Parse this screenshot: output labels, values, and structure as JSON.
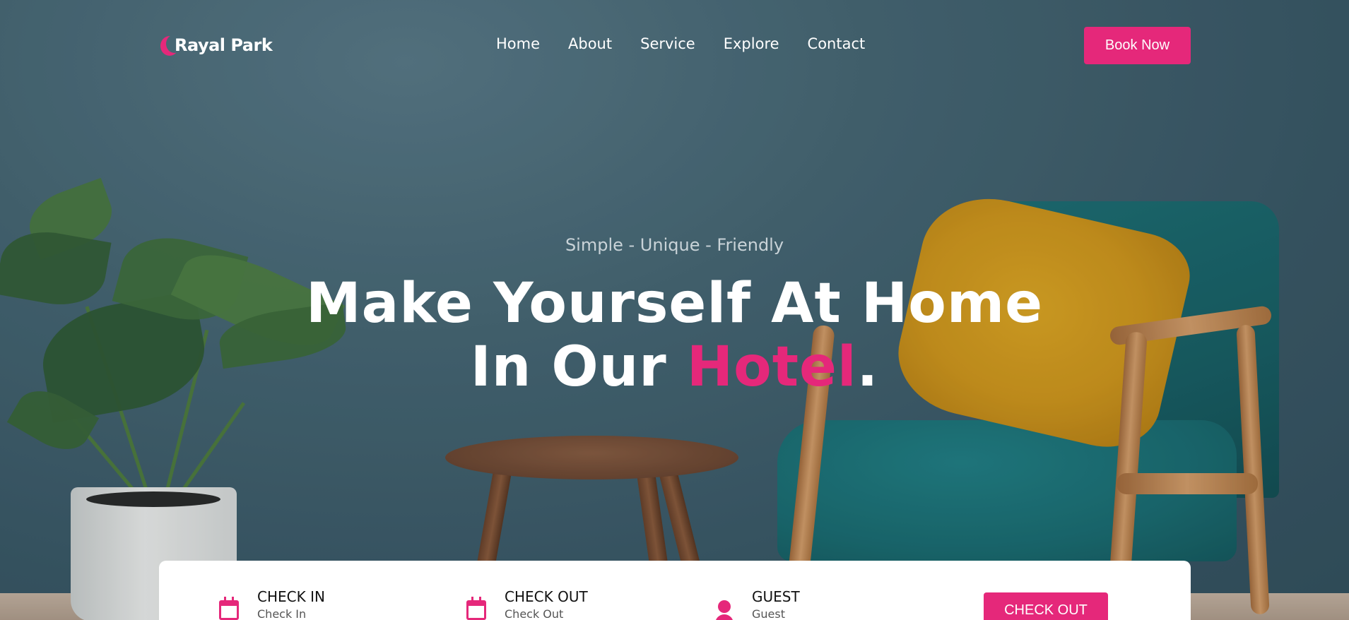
{
  "brand": {
    "name": "Rayal Park",
    "accent_color": "#e5287a"
  },
  "nav": {
    "items": [
      {
        "label": "Home"
      },
      {
        "label": "About"
      },
      {
        "label": "Service"
      },
      {
        "label": "Explore"
      },
      {
        "label": "Contact"
      }
    ],
    "cta_label": "Book Now"
  },
  "hero": {
    "tagline": "Simple - Unique - Friendly",
    "headline_line1": "Make Yourself At Home",
    "headline_line2_prefix": "In Our ",
    "headline_line2_accent": "Hotel",
    "headline_line2_suffix": "."
  },
  "booking": {
    "fields": [
      {
        "label": "CHECK IN",
        "placeholder": "Check In",
        "icon": "calendar-icon"
      },
      {
        "label": "CHECK OUT",
        "placeholder": "Check Out",
        "icon": "calendar-icon"
      },
      {
        "label": "GUEST",
        "placeholder": "Guest",
        "icon": "user-icon"
      }
    ],
    "submit_label": "CHECK OUT"
  }
}
